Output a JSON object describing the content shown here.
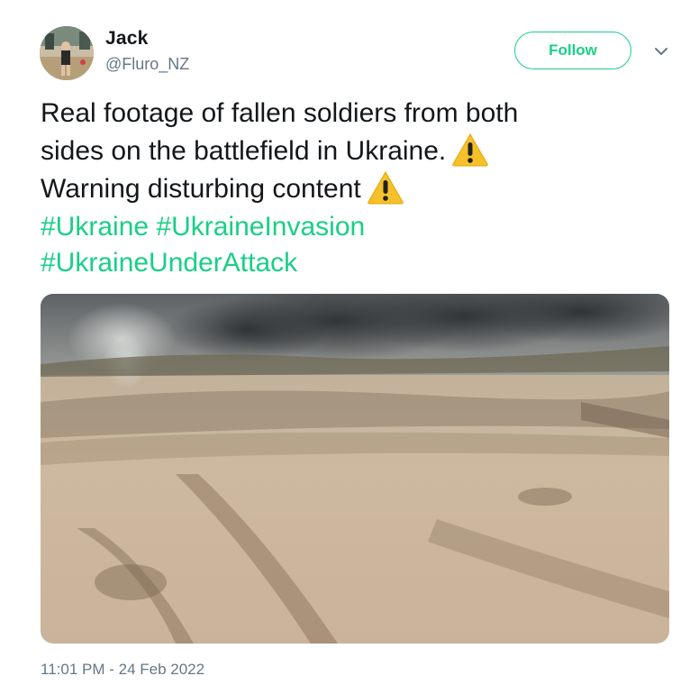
{
  "author": {
    "name": "Jack",
    "handle": "@Fluro_NZ"
  },
  "header": {
    "follow_label": "Follow",
    "menu_icon": "chevron-down-icon"
  },
  "tweet": {
    "line1": "Real footage of fallen soldiers from both",
    "line2": "sides on the battlefield in Ukraine.",
    "line3": "Warning disturbing content",
    "hashtags": [
      "#Ukraine",
      "#UkraineInvasion",
      "#UkraineUnderAttack"
    ],
    "warning_icon": "warning-emoji-icon"
  },
  "media": {
    "kind": "video-still",
    "scene": "battlefield-field-with-smoke"
  },
  "footer": {
    "timestamp": "11:01 PM - 24 Feb 2022"
  },
  "colors": {
    "accent": "#19cf86",
    "text": "#14171a",
    "secondary": "#657786"
  }
}
